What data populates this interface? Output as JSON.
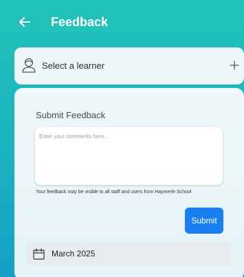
{
  "header": {
    "title": "Feedback",
    "back_icon": "arrow-left-icon"
  },
  "learner": {
    "label": "Select a learner",
    "icon": "user-icon",
    "add_icon": "plus-icon"
  },
  "feedback": {
    "section_title": "Submit Feedback",
    "comments_placeholder": "Enter your comments here...",
    "comments_value": "",
    "visibility_note": "Your feedback may be visible to all staff and users from Haymerle School",
    "submit_label": "Submit"
  },
  "month": {
    "label": "March 2025",
    "icon": "calendar-icon"
  },
  "colors": {
    "header_gradient_top": "#22c3b8",
    "header_gradient_bottom": "#15a0c6",
    "submit_button": "#1a7ff0",
    "card_background": "#eef8f9"
  }
}
